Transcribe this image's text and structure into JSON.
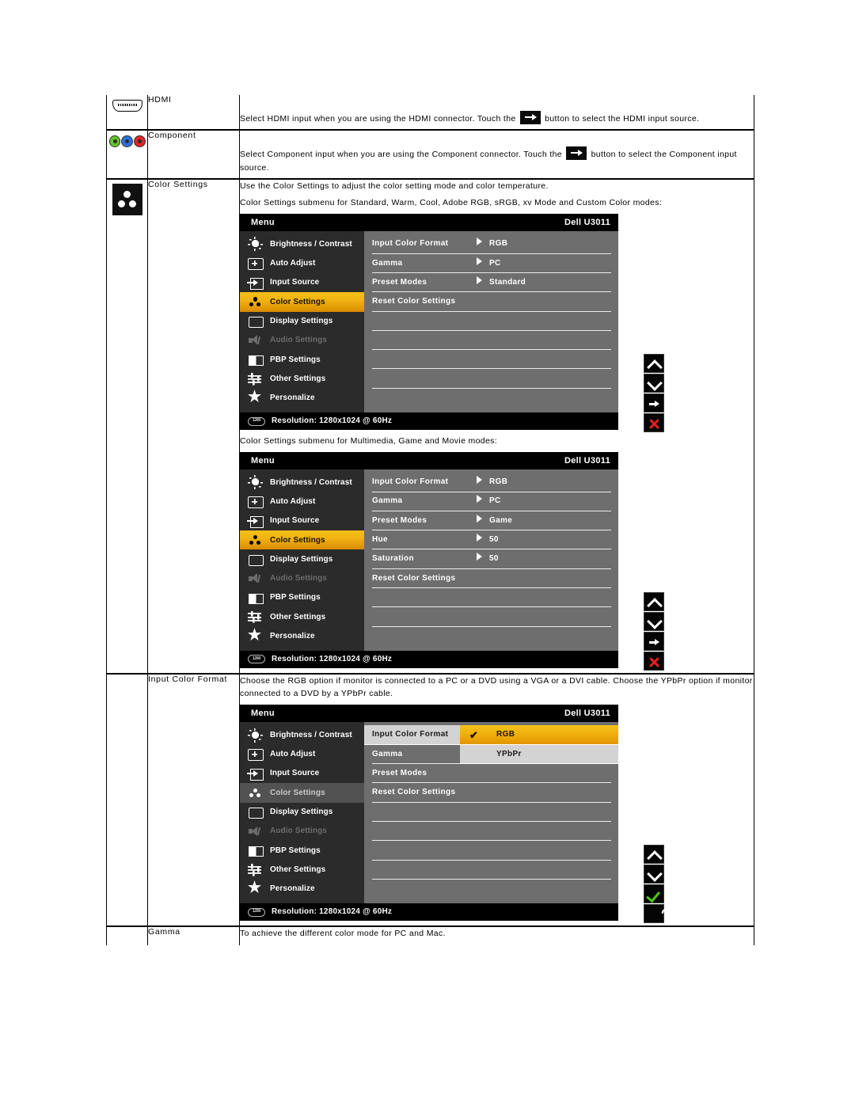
{
  "rows": [
    {
      "icon": "hdmi-connector-icon",
      "name": "HDMI",
      "desc_pre": "Select HDMI input when you are using the HDMI connector. Touch the",
      "desc_post": "button to select the HDMI input source."
    },
    {
      "icon": "component-rca-jacks-icon",
      "name": "Component",
      "desc_pre": "Select Component input when you are using the Component connector. Touch the",
      "desc_post": "button to select the Component input source."
    },
    {
      "icon": "color-settings-dots-icon",
      "name": "Color Settings",
      "line1": "Use the Color Settings to adjust the color setting mode and color temperature.",
      "caption1": "Color Settings submenu for Standard, Warm, Cool, Adobe RGB, sRGB, xv Mode and Custom Color modes:",
      "caption2": "Color Settings submenu for Multimedia, Game and Movie modes:"
    },
    {
      "icon": "",
      "name": "Input Color Format",
      "desc": "Choose the RGB option if monitor is connected to a PC or a DVD using a VGA or a DVI cable. Choose the YPbPr option if monitor connected to a DVD by a YPbPr cable."
    },
    {
      "icon": "",
      "name": "Gamma",
      "desc": "To achieve the different color mode for PC and Mac."
    }
  ],
  "osd_common": {
    "menu_label": "Menu",
    "model": "Dell U3011",
    "resolution": "Resolution: 1280x1024 @ 60Hz",
    "res_badge": "1280",
    "sidebar": [
      {
        "label": "Brightness / Contrast",
        "icon": "brightness-contrast-icon",
        "state": "normal"
      },
      {
        "label": "Auto Adjust",
        "icon": "auto-adjust-icon",
        "state": "normal"
      },
      {
        "label": "Input Source",
        "icon": "input-source-icon",
        "state": "normal"
      },
      {
        "label": "Color Settings",
        "icon": "color-settings-icon",
        "state": "active"
      },
      {
        "label": "Display Settings",
        "icon": "display-settings-icon",
        "state": "normal"
      },
      {
        "label": "Audio Settings",
        "icon": "audio-settings-icon",
        "state": "disabled"
      },
      {
        "label": "PBP Settings",
        "icon": "pbp-settings-icon",
        "state": "normal"
      },
      {
        "label": "Other Settings",
        "icon": "other-settings-icon",
        "state": "normal"
      },
      {
        "label": "Personalize",
        "icon": "personalize-star-icon",
        "state": "normal"
      }
    ]
  },
  "osd1": {
    "rows": [
      {
        "name": "Input Color Format",
        "value": "RGB",
        "arrow": true
      },
      {
        "name": "Gamma",
        "value": "PC",
        "arrow": true
      },
      {
        "name": "Preset Modes",
        "value": "Standard",
        "arrow": true
      },
      {
        "name": "Reset Color Settings",
        "value": "",
        "arrow": false
      }
    ],
    "blank_rows": 5,
    "nav": [
      "up-arrow-icon",
      "down-arrow-icon",
      "right-arrow-icon",
      "close-x-icon"
    ]
  },
  "osd2": {
    "rows": [
      {
        "name": "Input Color Format",
        "value": "RGB",
        "arrow": true
      },
      {
        "name": "Gamma",
        "value": "PC",
        "arrow": true
      },
      {
        "name": "Preset Modes",
        "value": "Game",
        "arrow": true
      },
      {
        "name": "Hue",
        "value": "50",
        "arrow": true
      },
      {
        "name": "Saturation",
        "value": "50",
        "arrow": true
      },
      {
        "name": "Reset Color Settings",
        "value": "",
        "arrow": false
      }
    ],
    "blank_rows": 3,
    "nav": [
      "up-arrow-icon",
      "down-arrow-icon",
      "right-arrow-icon",
      "close-x-icon"
    ]
  },
  "osd3": {
    "rows": [
      {
        "name": "Input Color Format",
        "value": "",
        "arrow": false,
        "selected": true
      },
      {
        "name": "Gamma",
        "value": "",
        "arrow": false
      },
      {
        "name": "Preset Modes",
        "value": "",
        "arrow": false
      },
      {
        "name": "Reset Color Settings",
        "value": "",
        "arrow": false
      }
    ],
    "submenu": [
      {
        "label": "RGB",
        "checked": true
      },
      {
        "label": "YPbPr",
        "checked": false
      }
    ],
    "check_glyph": "✔",
    "blank_rows": 5,
    "sidebar_active_index": 3,
    "nav": [
      "up-arrow-icon",
      "down-arrow-icon",
      "confirm-check-icon",
      "back-arrow-icon"
    ]
  },
  "colors": {
    "highlight_gold": "#f0b413",
    "osd_panel_gray": "#6e6e6e",
    "osd_sidebar_dark": "#2b2b2b",
    "submenu_gray": "#d3d3d3",
    "close_red": "#e02020",
    "confirm_green": "#52c41a"
  }
}
